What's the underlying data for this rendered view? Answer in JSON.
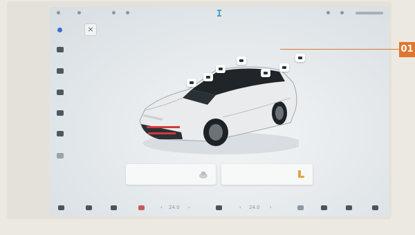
{
  "status_bar": {
    "left_items": [
      "",
      "",
      "",
      ""
    ],
    "center_icon": "car-ev-icon",
    "right_items": [
      "",
      ""
    ]
  },
  "sidebar": {
    "items": [
      {
        "icon": "bluetooth-icon",
        "active": true
      },
      {
        "icon": "car-icon"
      },
      {
        "icon": "media-icon"
      },
      {
        "icon": "fan-icon"
      },
      {
        "icon": "wrench-icon"
      },
      {
        "icon": "camera-icon"
      },
      {
        "icon": "settings-icon"
      }
    ]
  },
  "close_button": {
    "glyph": "×"
  },
  "vehicle": {
    "hotspots": [
      "door-lock",
      "window",
      "sunroof",
      "mirror",
      "trunk",
      "light",
      "camera"
    ]
  },
  "cards": [
    {
      "label": "",
      "icon": "seat-heat-icon"
    },
    {
      "label": "",
      "icon": "seat-icon"
    }
  ],
  "dock": {
    "left_temp": "24.0",
    "right_temp": "24.0"
  },
  "callout": {
    "label": "01",
    "color": "#e0762d"
  }
}
